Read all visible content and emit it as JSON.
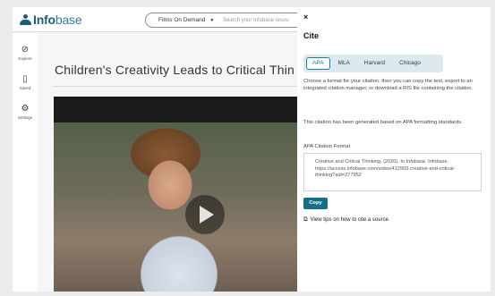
{
  "header": {
    "logo_text_bold": "Info",
    "logo_text_light": "base",
    "product_select": "Films On Demand",
    "search_placeholder": "Search your Infobase resou"
  },
  "rail": {
    "items": [
      {
        "label": "Explore",
        "icon": "compass-icon"
      },
      {
        "label": "Saved",
        "icon": "bookmark-icon"
      },
      {
        "label": "Settings",
        "icon": "settings-icon"
      }
    ]
  },
  "main": {
    "title": "Children's Creativity Leads to Critical Thin"
  },
  "cite": {
    "close_label": "×",
    "heading": "Cite",
    "tabs": [
      "APA",
      "MLA",
      "Harvard",
      "Chicago"
    ],
    "active_tab": "APA",
    "intro": "Choose a format for your citation, then you can copy the text, export to an integrated citation manager, or download a RIS file containing the citation.",
    "generated": "This citation has been generated based on APA formatting standards.",
    "format_label": "APA Citation Format",
    "citation_part1": "Creative and Critical Thinking. (2020). In ",
    "citation_italic": "Infobase",
    "citation_part2": ". Infobase. https://access.infobase.com/video/412903-creative-and-critical-thinking?aid=277952",
    "copy_label": "Copy",
    "tips_label": "View tips on how to cite a source"
  },
  "colors": {
    "brand": "#1c5e78",
    "accent": "#166f88",
    "tab_active_border": "#1c7ea2"
  }
}
